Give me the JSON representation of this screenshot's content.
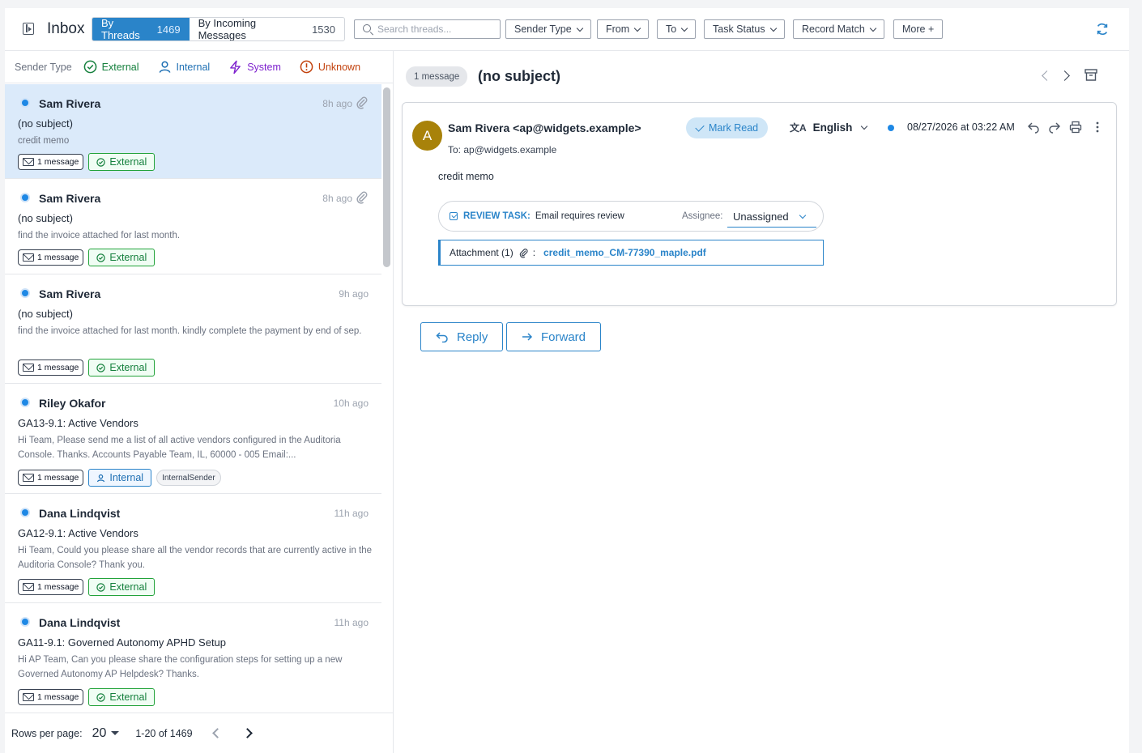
{
  "header": {
    "title": "Inbox",
    "view_toggle": [
      {
        "label": "By Threads",
        "count": "1469",
        "active": true
      },
      {
        "label": "By Incoming Messages",
        "count": "1530",
        "active": false
      }
    ],
    "search_placeholder": "Search threads...",
    "filters": [
      "Sender Type",
      "From",
      "To",
      "Task Status",
      "Record Match"
    ],
    "more_label": "More +"
  },
  "legend": {
    "label": "Sender Type",
    "items": [
      {
        "label": "External",
        "color": "#15803d",
        "icon": "check-circle-icon"
      },
      {
        "label": "Internal",
        "color": "#1e6fb3",
        "icon": "person-icon"
      },
      {
        "label": "System",
        "color": "#7e22ce",
        "icon": "lightning-icon"
      },
      {
        "label": "Unknown",
        "color": "#c2410c",
        "icon": "alert-circle-icon"
      }
    ]
  },
  "threads": [
    {
      "sender": "Sam Rivera",
      "time": "8h ago",
      "subject": "(no subject)",
      "preview": "credit memo",
      "msg_chip": "1 message",
      "type": "External",
      "has_attachment": true,
      "selected": true
    },
    {
      "sender": "Sam Rivera",
      "time": "8h ago",
      "subject": "(no subject)",
      "preview": "find the invoice attached for last month.",
      "msg_chip": "1 message",
      "type": "External",
      "has_attachment": true,
      "selected": false
    },
    {
      "sender": "Sam Rivera",
      "time": "9h ago",
      "subject": "(no subject)",
      "preview": "find the invoice attached for last month. kindly complete the payment by end of sep.",
      "msg_chip": "1 message",
      "type": "External",
      "has_attachment": false,
      "selected": false
    },
    {
      "sender": "Riley Okafor",
      "time": "10h ago",
      "subject": "GA13-9.1: Active Vendors",
      "preview": "Hi Team, Please send me a list of all active vendors configured in the Auditoria Console. Thanks. Accounts Payable Team, IL, 60000 - 005 Email:...",
      "msg_chip": "1 message",
      "type": "Internal",
      "extra_tag": "InternalSender",
      "has_attachment": false,
      "selected": false
    },
    {
      "sender": "Dana Lindqvist",
      "time": "11h ago",
      "subject": "GA12-9.1: Active Vendors",
      "preview": "Hi Team, Could you please share all the vendor records that are currently active in the Auditoria Console? Thank you.",
      "msg_chip": "1 message",
      "type": "External",
      "has_attachment": false,
      "selected": false
    },
    {
      "sender": "Dana Lindqvist",
      "time": "11h ago",
      "subject": "GA11-9.1: Governed Autonomy APHD Setup",
      "preview": "Hi AP Team, Can you please share the configuration steps for setting up a new Governed Autonomy AP Helpdesk? Thanks.",
      "msg_chip": "1 message",
      "type": "External",
      "has_attachment": false,
      "selected": false
    }
  ],
  "pager": {
    "rows_label": "Rows per page:",
    "rows_value": "20",
    "range": "1-20 of 1469"
  },
  "detail": {
    "msg_count": "1 message",
    "title": "(no subject)",
    "avatar_letter": "A",
    "from": "Sam Rivera <ap@widgets.example>",
    "to": "To: ap@widgets.example",
    "mark_read": "Mark Read",
    "language_icon": "文A",
    "language": "English",
    "date": "08/27/2026 at 03:22 AM",
    "body": "credit memo",
    "task": {
      "label": "REVIEW TASK:",
      "description": "Email requires review",
      "assignee_label": "Assignee:",
      "assignee": "Unassigned"
    },
    "attachment": {
      "label": "Attachment (1)",
      "separator": ":",
      "file": "credit_memo_CM-77390_maple.pdf"
    },
    "reply_label": "Reply",
    "forward_label": "Forward"
  },
  "colors": {
    "accent": "#2a84c9",
    "external": "#15803d",
    "internal": "#1e6fb3",
    "selected_row": "#dbeafa",
    "avatar": "#a8820a"
  }
}
